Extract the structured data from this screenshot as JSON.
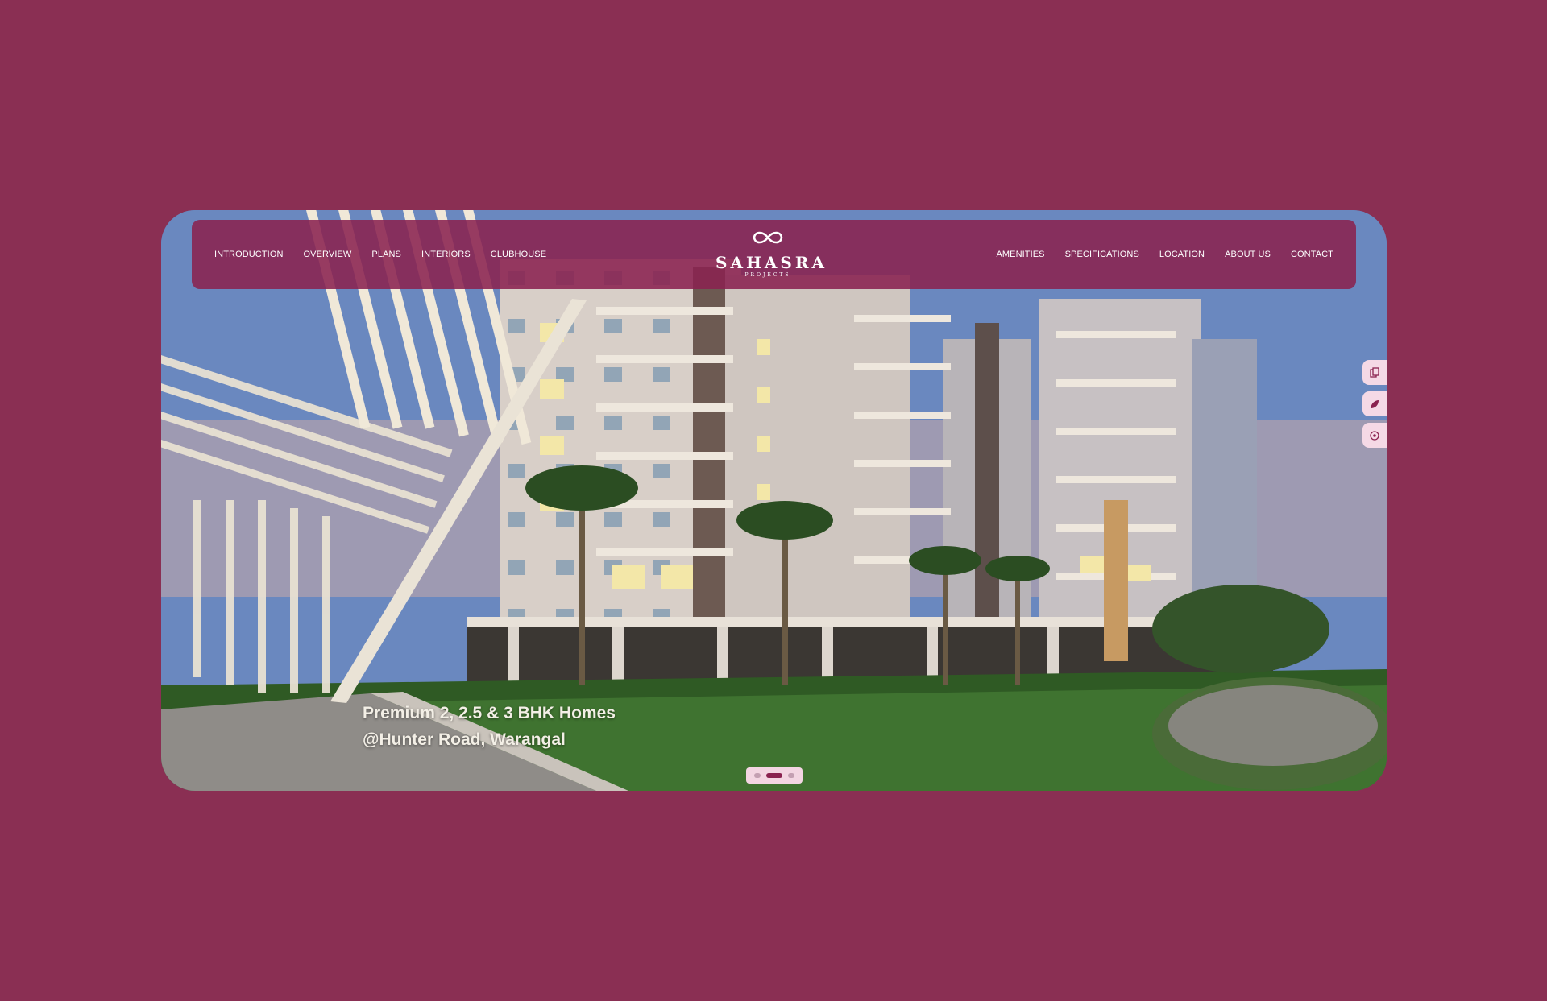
{
  "nav": {
    "left": [
      "INTRODUCTION",
      "OVERVIEW",
      "PLANS",
      "INTERIORS",
      "CLUBHOUSE"
    ],
    "right": [
      "AMENITIES",
      "SPECIFICATIONS",
      "LOCATION",
      "ABOUT US",
      "CONTACT"
    ]
  },
  "logo": {
    "title": "SAHASRA",
    "subtitle": "PROJECTS",
    "icon": "infinity-loop-icon"
  },
  "hero": {
    "line1": "Premium 2, 2.5 & 3 BHK Homes",
    "line2": "@Hunter Road, Warangal"
  },
  "slider": {
    "count": 3,
    "active_index": 1
  },
  "side_tools": [
    "brochure-icon",
    "leaf-icon",
    "location-icon"
  ],
  "colors": {
    "brand": "#8a2250",
    "page_bg": "#8a2f53",
    "tool_bg": "#f5d9e6"
  }
}
